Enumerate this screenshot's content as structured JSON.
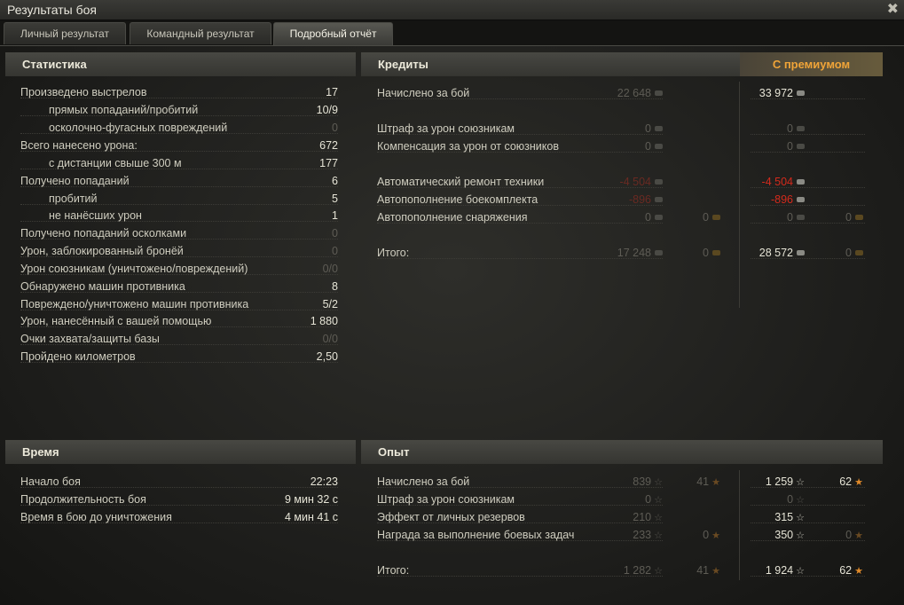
{
  "window": {
    "title": "Результаты боя",
    "close_glyph": "✖"
  },
  "tabs": [
    {
      "label": "Личный результат",
      "active": false
    },
    {
      "label": "Командный результат",
      "active": false
    },
    {
      "label": "Подробный отчёт",
      "active": true
    }
  ],
  "stats": {
    "heading": "Статистика",
    "rows": [
      {
        "label": "Произведено выстрелов",
        "value": "17"
      },
      {
        "label": "прямых попаданий/пробитий",
        "value": "10/9"
      },
      {
        "label": "осколочно-фугасных повреждений",
        "value": "0"
      },
      {
        "label": "Всего нанесено урона:",
        "value": "672"
      },
      {
        "label": "с дистанции свыше 300 м",
        "value": "177"
      },
      {
        "label": "Получено попаданий",
        "value": "6"
      },
      {
        "label": "пробитий",
        "value": "5"
      },
      {
        "label": "не нанёсших урон",
        "value": "1"
      },
      {
        "label": "Получено попаданий осколками",
        "value": "0"
      },
      {
        "label": "Урон, заблокированный бронёй",
        "value": "0"
      },
      {
        "label": "Урон союзникам (уничтожено/повреждений)",
        "value": "0/0"
      },
      {
        "label": "Обнаружено машин противника",
        "value": "8"
      },
      {
        "label": "Повреждено/уничтожено машин противника",
        "value": "5/2"
      },
      {
        "label": "Урон, нанесённый с вашей помощью",
        "value": "1 880"
      },
      {
        "label": "Очки захвата/защиты базы",
        "value": "0/0"
      },
      {
        "label": "Пройдено километров",
        "value": "2,50"
      }
    ]
  },
  "credits": {
    "heading": "Кредиты",
    "premium_heading": "С премиумом",
    "rows": [
      {
        "label": "Начислено за бой",
        "base": "22 648",
        "base_gold": "",
        "prem": "33 972",
        "prem_gold": ""
      },
      {
        "label": "Штраф за урон союзникам",
        "base": "0",
        "base_gold": "",
        "prem": "0",
        "prem_gold": ""
      },
      {
        "label": "Компенсация за урон от союзников",
        "base": "0",
        "base_gold": "",
        "prem": "0",
        "prem_gold": ""
      },
      {
        "label": "Автоматический ремонт техники",
        "base": "-4 504",
        "base_gold": "",
        "prem": "-4 504",
        "prem_gold": ""
      },
      {
        "label": "Автопополнение боекомплекта",
        "base": "-896",
        "base_gold": "",
        "prem": "-896",
        "prem_gold": ""
      },
      {
        "label": "Автопополнение снаряжения",
        "base": "0",
        "base_gold": "0",
        "prem": "0",
        "prem_gold": "0"
      },
      {
        "label": "Итого:",
        "base": "17 248",
        "base_gold": "0",
        "prem": "28 572",
        "prem_gold": "0"
      }
    ]
  },
  "time": {
    "heading": "Время",
    "rows": [
      {
        "label": "Начало боя",
        "value": "22:23"
      },
      {
        "label": "Продолжительность боя",
        "value": "9 мин 32 с"
      },
      {
        "label": "Время в бою до уничтожения",
        "value": "4 мин 41 с"
      }
    ]
  },
  "xp": {
    "heading": "Опыт",
    "rows": [
      {
        "label": "Начислено за бой",
        "base": "839",
        "base_free": "41",
        "prem": "1 259",
        "prem_free": "62"
      },
      {
        "label": "Штраф за урон союзникам",
        "base": "0",
        "base_free": "",
        "prem": "0",
        "prem_free": ""
      },
      {
        "label": "Эффект от личных резервов",
        "base": "210",
        "base_free": "",
        "prem": "315",
        "prem_free": ""
      },
      {
        "label": "Награда за выполнение боевых задач",
        "base": "233",
        "base_free": "0",
        "prem": "350",
        "prem_free": "0"
      },
      {
        "label": "Итого:",
        "base": "1 282",
        "base_free": "41",
        "prem": "1 924",
        "prem_free": "62"
      }
    ]
  }
}
